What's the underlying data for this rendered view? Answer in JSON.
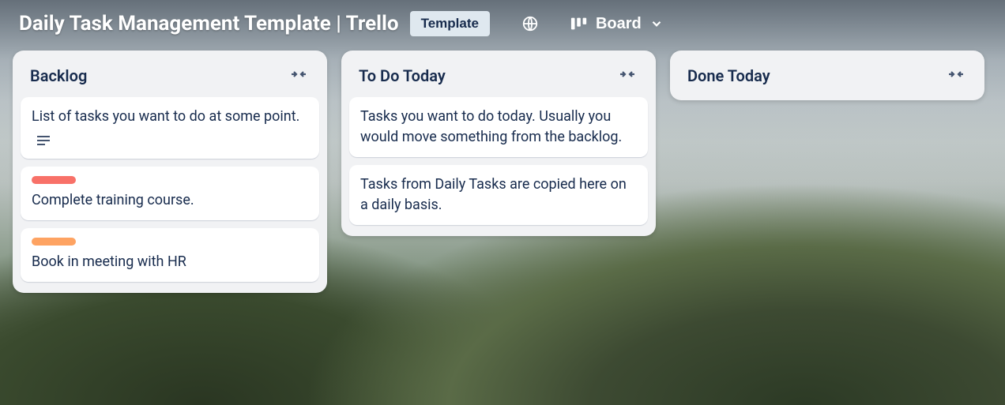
{
  "header": {
    "title": "Daily Task Management Template | Trello",
    "template_badge": "Template",
    "view_label": "Board"
  },
  "lists": [
    {
      "title": "Backlog",
      "cards": [
        {
          "text": "List of tasks you want to do at some point.",
          "has_description": true
        },
        {
          "text": "Complete training course.",
          "label_color": "#f87168"
        },
        {
          "text": "Book in meeting with HR",
          "label_color": "#fea362"
        }
      ]
    },
    {
      "title": "To Do Today",
      "cards": [
        {
          "text": "Tasks you want to do today. Usually you would move something from the backlog."
        },
        {
          "text": "Tasks from Daily Tasks are copied here on a daily basis."
        }
      ]
    },
    {
      "title": "Done Today",
      "cards": []
    }
  ]
}
